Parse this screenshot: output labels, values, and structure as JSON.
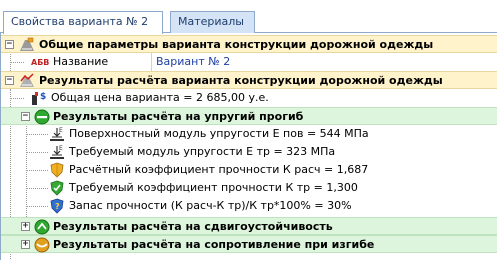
{
  "tabs": [
    {
      "label": "Свойства варианта № 2",
      "active": true
    },
    {
      "label": "Материалы",
      "active": false
    }
  ],
  "general_section": {
    "title": "Общие параметры варианта конструкции дорожной одежды",
    "property_badge": "АБВ",
    "name_label": "Название",
    "name_value": "Вариант № 2"
  },
  "results_section": {
    "title": "Результаты расчёта варианта конструкции дорожной одежды",
    "total_price": "Общая цена варианта = 2 685,00 у.е.",
    "elastic": {
      "title": "Результаты расчёта на упругий прогиб",
      "items": [
        {
          "text": "Поверхностный модуль упругости Е пов = 544 МПа",
          "icon": "modulus-icon"
        },
        {
          "text": "Требуемый модуль упругости Е тр = 323 МПа",
          "icon": "modulus-icon"
        },
        {
          "text": "Расчётный коэффициент прочности К расч = 1,687",
          "icon": "shield-icon"
        },
        {
          "text": "Требуемый коэффициент прочности К тр = 1,300",
          "icon": "shield-check-icon"
        },
        {
          "text": "Запас прочности (К расч-К тр)/К тр*100% = 30%",
          "icon": "info-shield-icon"
        }
      ]
    },
    "shear": {
      "title": "Результаты расчёта на сдвигоустойчивость"
    },
    "bending": {
      "title": "Результаты расчёта на сопротивление при изгибе"
    }
  },
  "colors": {
    "section_bg": "#fff3cc",
    "subsection_bg": "#ddf5dd",
    "tab_inactive_bg": "#d4e3f5",
    "value_text": "#1f3fa0"
  }
}
